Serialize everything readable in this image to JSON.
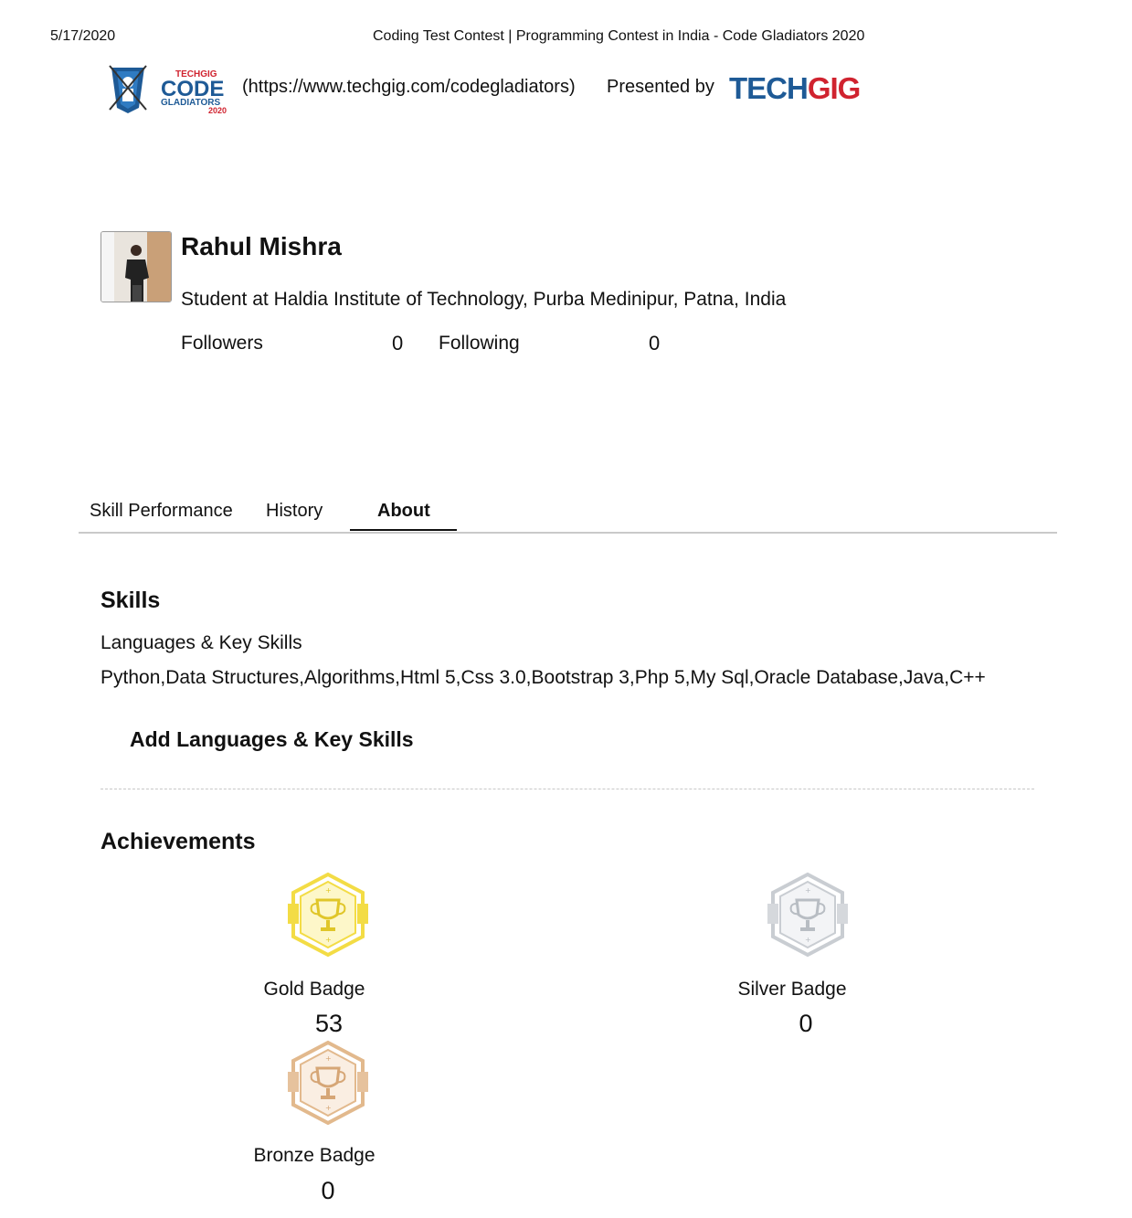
{
  "print_header": {
    "date": "5/17/2020",
    "title": "Coding Test Contest | Programming Contest in India - Code Gladiators 2020"
  },
  "brand": {
    "logo_top": "TECHGIG",
    "logo_main": "CODE",
    "logo_sub": "GLADIATORS",
    "logo_year": "2020",
    "link": "(https://www.techgig.com/codegladiators)",
    "presented_by": "Presented by",
    "techgig_part1": "TECH",
    "techgig_part2": "GIG",
    "colors": {
      "blue": "#1e5a96",
      "red": "#d0232f"
    }
  },
  "profile": {
    "name": "Rahul Mishra",
    "subtitle": "Student at Haldia Institute of Technology, Purba Medinipur, Patna, India",
    "followers_label": "Followers",
    "followers_count": "0",
    "following_label": "Following",
    "following_count": "0"
  },
  "tabs": [
    {
      "label": "Skill Performance",
      "active": false
    },
    {
      "label": "History",
      "active": false
    },
    {
      "label": "About",
      "active": true
    }
  ],
  "skills": {
    "title": "Skills",
    "subtitle": "Languages & Key Skills",
    "list": "Python,Data Structures,Algorithms,Html 5,Css 3.0,Bootstrap 3,Php 5,My Sql,Oracle Database,Java,C++",
    "add_label": "Add Languages & Key Skills"
  },
  "achievements": {
    "title": "Achievements",
    "badges": [
      {
        "label": "Gold Badge",
        "count": "53",
        "color": "#f3dc45"
      },
      {
        "label": "Silver Badge",
        "count": "0",
        "color": "#c9cdd2"
      },
      {
        "label": "Bronze Badge",
        "count": "0",
        "color": "#e2b98d"
      }
    ]
  }
}
